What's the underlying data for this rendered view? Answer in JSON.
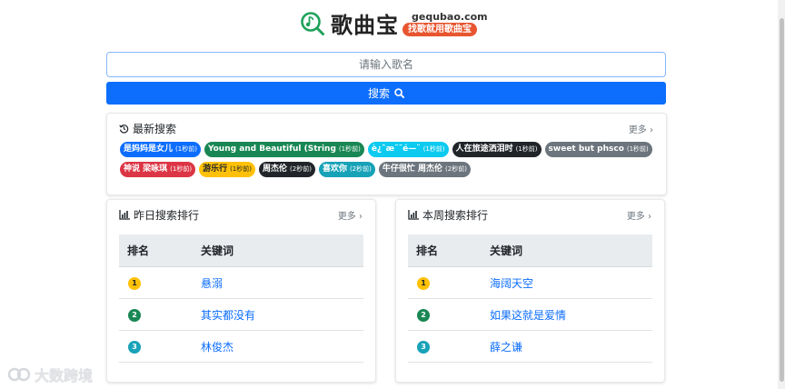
{
  "brand": {
    "name": "歌曲宝",
    "domain": "gequbao.com",
    "slogan": "找歌就用歌曲宝",
    "accent_color": "#20a15a",
    "slogan_color": "#e8552f"
  },
  "search": {
    "placeholder": "请输入歌名",
    "button_label": "搜索",
    "button_color": "#0d6efd"
  },
  "recent": {
    "title": "最新搜索",
    "more": "更多",
    "tags": [
      {
        "keyword": "是妈妈是女儿",
        "time": "(1秒前)",
        "color": "#0d6efd",
        "text_color": "#ffffff"
      },
      {
        "keyword": "Young and Beautiful (String",
        "time": "(1秒前)",
        "color": "#198754",
        "text_color": "#ffffff"
      },
      {
        "keyword": "è¿ˆæ˜¯é—¨",
        "time": "(1秒前)",
        "color": "#0dcaf0",
        "text_color": "#ffffff"
      },
      {
        "keyword": "人在旅途洒泪时",
        "time": "(1秒前)",
        "color": "#212529",
        "text_color": "#ffffff"
      },
      {
        "keyword": "sweet but phsco",
        "time": "(1秒前)",
        "color": "#6c757d",
        "text_color": "#ffffff"
      },
      {
        "keyword": "神说 梁咏琪",
        "time": "(1秒前)",
        "color": "#dc3545",
        "text_color": "#ffffff"
      },
      {
        "keyword": "游乐行",
        "time": "(1秒前)",
        "color": "#ffc107",
        "text_color": "#212529"
      },
      {
        "keyword": "周杰伦",
        "time": "(2秒前)",
        "color": "#212529",
        "text_color": "#ffffff"
      },
      {
        "keyword": "喜欢你",
        "time": "(2秒前)",
        "color": "#17a2b8",
        "text_color": "#ffffff"
      },
      {
        "keyword": "牛仔很忙 周杰伦",
        "time": "(2秒前)",
        "color": "#6c757d",
        "text_color": "#ffffff"
      }
    ]
  },
  "yesterday": {
    "title": "昨日搜索排行",
    "more": "更多",
    "col_rank": "排名",
    "col_keyword": "关键词",
    "rows": [
      {
        "rank": "1",
        "keyword": "悬溺",
        "badge_color": "#ffc107",
        "badge_text_color": "#212529"
      },
      {
        "rank": "2",
        "keyword": "其实都没有",
        "badge_color": "#198754",
        "badge_text_color": "#ffffff"
      },
      {
        "rank": "3",
        "keyword": "林俊杰",
        "badge_color": "#17a2b8",
        "badge_text_color": "#ffffff"
      }
    ]
  },
  "week": {
    "title": "本周搜索排行",
    "more": "更多",
    "col_rank": "排名",
    "col_keyword": "关键词",
    "rows": [
      {
        "rank": "1",
        "keyword": "海阔天空",
        "badge_color": "#ffc107",
        "badge_text_color": "#212529"
      },
      {
        "rank": "2",
        "keyword": "如果这就是爱情",
        "badge_color": "#198754",
        "badge_text_color": "#ffffff"
      },
      {
        "rank": "3",
        "keyword": "薛之谦",
        "badge_color": "#17a2b8",
        "badge_text_color": "#ffffff"
      }
    ]
  },
  "watermark": "大数跨境",
  "icons": {
    "logo": "music-search-icon",
    "search": "search-icon",
    "history": "history-icon",
    "bar_chart": "bar-chart-icon",
    "chevron": "chevron-right-icon"
  }
}
